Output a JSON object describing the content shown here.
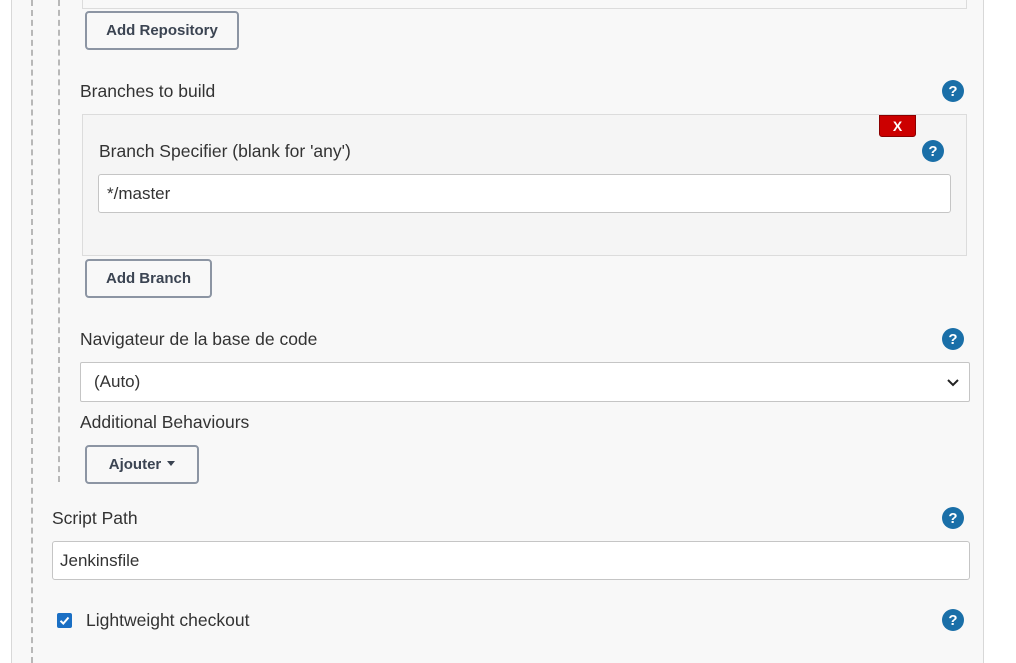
{
  "scm": {
    "add_repository_label": "Add Repository",
    "branches_to_build_label": "Branches to build",
    "branch_specifier_label": "Branch Specifier (blank for 'any')",
    "branch_specifier_value": "*/master",
    "delete_label": "X",
    "add_branch_label": "Add Branch",
    "browser_label": "Navigateur de la base de code",
    "browser_selected": "(Auto)",
    "additional_behaviours_label": "Additional Behaviours",
    "ajouter_label": "Ajouter"
  },
  "script": {
    "path_label": "Script Path",
    "path_value": "Jenkinsfile",
    "lightweight_label": "Lightweight checkout",
    "lightweight_checked": true
  },
  "help_glyph": "?",
  "colors": {
    "help": "#1a6fa8",
    "delete": "#cc0000",
    "checkbox": "#1a6fc4",
    "panel_bg": "#f8f8f8"
  }
}
